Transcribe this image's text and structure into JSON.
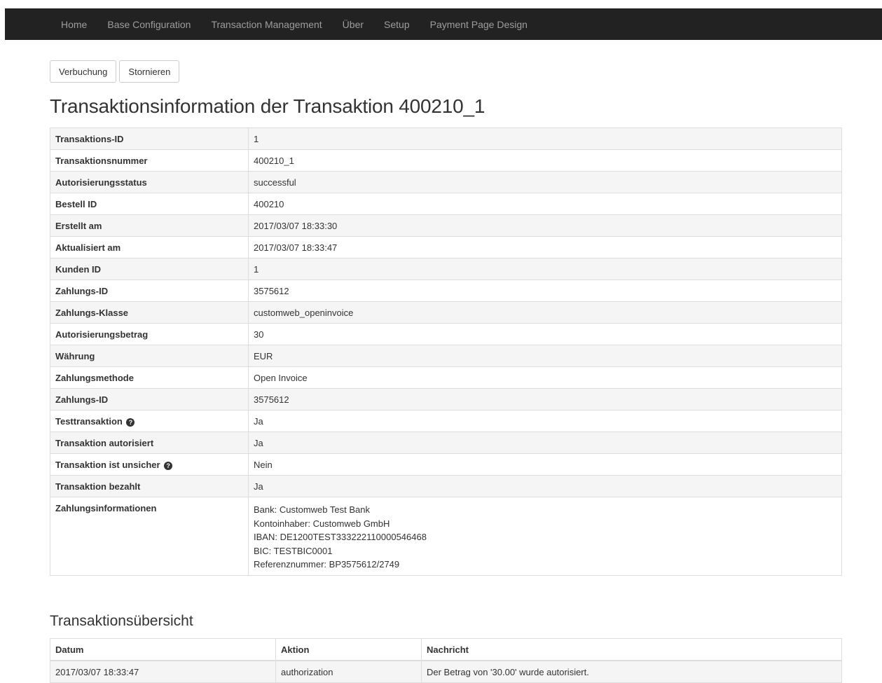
{
  "nav": {
    "items": [
      "Home",
      "Base Configuration",
      "Transaction Management",
      "Über",
      "Setup",
      "Payment Page Design"
    ]
  },
  "actions": {
    "capture_label": "Verbuchung",
    "cancel_label": "Stornieren"
  },
  "page_title": "Transaktionsinformation der Transaktion 400210_1",
  "info_rows": [
    {
      "key": "Transaktions-ID",
      "value": "1"
    },
    {
      "key": "Transaktionsnummer",
      "value": "400210_1"
    },
    {
      "key": "Autorisierungsstatus",
      "value": "successful"
    },
    {
      "key": "Bestell ID",
      "value": "400210"
    },
    {
      "key": "Erstellt am",
      "value": "2017/03/07 18:33:30"
    },
    {
      "key": "Aktualisiert am",
      "value": "2017/03/07 18:33:47"
    },
    {
      "key": "Kunden ID",
      "value": "1"
    },
    {
      "key": "Zahlungs-ID",
      "value": "3575612"
    },
    {
      "key": "Zahlungs-Klasse",
      "value": "customweb_openinvoice"
    },
    {
      "key": "Autorisierungsbetrag",
      "value": "30"
    },
    {
      "key": "Währung",
      "value": "EUR"
    },
    {
      "key": "Zahlungsmethode",
      "value": "Open Invoice"
    },
    {
      "key": "Zahlungs-ID",
      "value": "3575612"
    },
    {
      "key": "Testtransaktion",
      "value": "Ja",
      "help_icon": "question-circle-icon"
    },
    {
      "key": "Transaktion autorisiert",
      "value": "Ja"
    },
    {
      "key": "Transaktion ist unsicher",
      "value": "Nein",
      "help_icon": "question-circle-icon"
    },
    {
      "key": "Transaktion bezahlt",
      "value": "Ja"
    }
  ],
  "payment_info": {
    "key": "Zahlungsinformationen",
    "lines": [
      "Bank: Customweb Test Bank",
      "Kontoinhaber: Customweb GmbH",
      "IBAN: DE1200TEST333222110000546468",
      "BIC: TESTBIC0001",
      "Referenznummer: BP3575612/2749"
    ]
  },
  "overview": {
    "title": "Transaktionsübersicht",
    "columns": [
      "Datum",
      "Aktion",
      "Nachricht"
    ],
    "rows": [
      [
        "2017/03/07 18:33:47",
        "authorization",
        "Der Betrag von '30.00' wurde autorisiert."
      ]
    ]
  },
  "colors": {
    "navbar_bg": "#222222",
    "nav_text": "#9d9d9d",
    "stripe_bg": "#f5f5f5",
    "border": "#dddddd"
  }
}
